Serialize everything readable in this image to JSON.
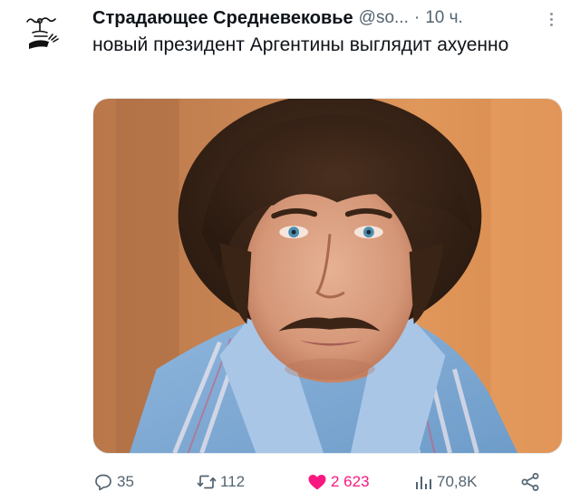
{
  "tweet": {
    "author": {
      "display_name": "Страдающее Средневековье",
      "handle": "@so...",
      "avatar_icon": "medieval-figure-icon"
    },
    "separator": "·",
    "timestamp": "10 ч.",
    "more_icon": "more-vertical-icon",
    "text": "новый президент Аргентины выглядит ахуенно",
    "media": {
      "type": "photo",
      "description_icon": "portrait-photo"
    },
    "actions": {
      "reply": {
        "icon": "reply-icon",
        "count": "35"
      },
      "retweet": {
        "icon": "retweet-icon",
        "count": "112"
      },
      "like": {
        "icon": "heart-filled-icon",
        "count": "2 623",
        "active": true,
        "color": "#f91880"
      },
      "views": {
        "icon": "views-icon",
        "count": "70,8K"
      },
      "share": {
        "icon": "share-icon"
      }
    }
  }
}
